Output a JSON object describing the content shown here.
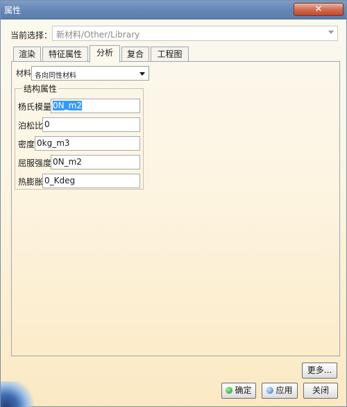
{
  "window": {
    "title": "属性",
    "close_icon": "close-icon"
  },
  "current_selection": {
    "label": "当前选择：",
    "value": "新材料/Other/Library"
  },
  "tabs": [
    {
      "label": "渲染",
      "active": false
    },
    {
      "label": "特征属性",
      "active": false
    },
    {
      "label": "分析",
      "active": true
    },
    {
      "label": "复合",
      "active": false
    },
    {
      "label": "工程图",
      "active": false
    }
  ],
  "material": {
    "label": "材料",
    "value": "各向同性材料"
  },
  "structural": {
    "title": "结构属性",
    "fields": [
      {
        "label": "杨氏模量",
        "value": "0N_m2",
        "selected": true
      },
      {
        "label": "泊松比",
        "value": "0",
        "selected": false
      },
      {
        "label": "密度",
        "value": "0kg_m3",
        "selected": false
      },
      {
        "label": "屈服强度",
        "value": "0N_m2",
        "selected": false
      },
      {
        "label": "热膨胀",
        "value": "0_Kdeg",
        "selected": false
      }
    ]
  },
  "buttons": {
    "more": "更多...",
    "ok": "确定",
    "apply": "应用",
    "close": "关闭"
  },
  "colors": {
    "titlebar": "#6487b6",
    "selection_highlight": "#3399ff",
    "panel_bg": "#fdf5e2"
  }
}
